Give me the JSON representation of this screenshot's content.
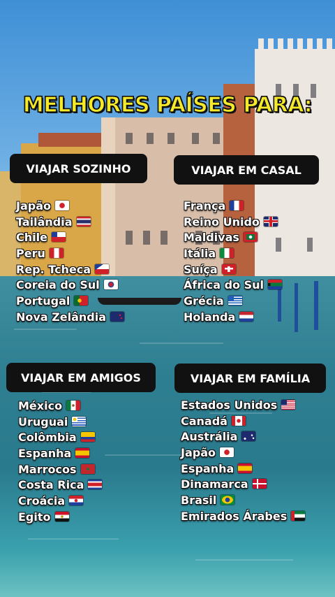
{
  "title": "MELHORES PAÍSES PARA:",
  "sections": [
    {
      "heading": "VIAJAR SOZINHO",
      "items": [
        {
          "name": "Japão",
          "flag": "jp-flag-icon"
        },
        {
          "name": "Tailândia",
          "flag": "th-flag-icon"
        },
        {
          "name": "Chile",
          "flag": "cl-flag-icon"
        },
        {
          "name": "Peru",
          "flag": "pe-flag-icon"
        },
        {
          "name": "Rep. Tcheca",
          "flag": "cz-flag-icon"
        },
        {
          "name": "Coreia do Sul",
          "flag": "kr-flag-icon"
        },
        {
          "name": "Portugal",
          "flag": "pt-flag-icon"
        },
        {
          "name": "Nova Zelândia",
          "flag": "nz-flag-icon"
        }
      ]
    },
    {
      "heading": "VIAJAR EM CASAL",
      "items": [
        {
          "name": "França",
          "flag": "fr-flag-icon"
        },
        {
          "name": "Reino Unido",
          "flag": "gb-flag-icon"
        },
        {
          "name": "Maldivas",
          "flag": "mv-flag-icon"
        },
        {
          "name": "Itália",
          "flag": "it-flag-icon"
        },
        {
          "name": "Suíça",
          "flag": "ch-flag-icon"
        },
        {
          "name": "África do Sul",
          "flag": "za-flag-icon"
        },
        {
          "name": "Grécia",
          "flag": "gr-flag-icon"
        },
        {
          "name": "Holanda",
          "flag": "nl-flag-icon"
        }
      ]
    },
    {
      "heading": "VIAJAR EM AMIGOS",
      "items": [
        {
          "name": "México",
          "flag": "mx-flag-icon"
        },
        {
          "name": "Uruguai",
          "flag": "uy-flag-icon"
        },
        {
          "name": "Colômbia",
          "flag": "co-flag-icon"
        },
        {
          "name": "Espanha",
          "flag": "es-flag-icon"
        },
        {
          "name": "Marrocos",
          "flag": "ma-flag-icon"
        },
        {
          "name": "Costa Rica",
          "flag": "cr-flag-icon"
        },
        {
          "name": "Croácia",
          "flag": "hr-flag-icon"
        },
        {
          "name": "Egito",
          "flag": "eg-flag-icon"
        }
      ]
    },
    {
      "heading": "VIAJAR EM FAMÍLIA",
      "items": [
        {
          "name": "Estados Unidos",
          "flag": "us-flag-icon"
        },
        {
          "name": "Canadá",
          "flag": "ca-flag-icon"
        },
        {
          "name": "Austrália",
          "flag": "au-flag-icon"
        },
        {
          "name": "Japão",
          "flag": "jp-flag-icon"
        },
        {
          "name": "Espanha",
          "flag": "es-flag-icon"
        },
        {
          "name": "Dinamarca",
          "flag": "dk-flag-icon"
        },
        {
          "name": "Brasil",
          "flag": "br-flag-icon"
        },
        {
          "name": "Emirados Árabes",
          "flag": "ae-flag-icon"
        }
      ]
    }
  ],
  "colors": {
    "title": "#f5ea2a",
    "pill_bg": "#111111",
    "text": "#ffffff"
  }
}
